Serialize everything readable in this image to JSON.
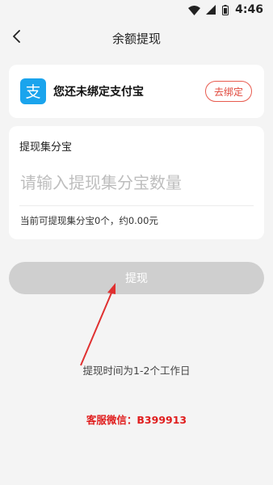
{
  "status_bar": {
    "time": "4:46",
    "icons": [
      "wifi-icon",
      "signal-icon",
      "battery-icon"
    ]
  },
  "nav": {
    "title": "余额提现",
    "back_icon": "chevron-left-icon"
  },
  "alipay": {
    "icon": "alipay-logo",
    "logo_char": "支",
    "status_text": "您还未绑定支付宝",
    "bind_label": "去绑定",
    "brand_color": "#1aa4ed",
    "accent_color": "#e0463a"
  },
  "withdraw": {
    "label": "提现集分宝",
    "amount_placeholder": "请输入提现集分宝数量",
    "amount_value": "",
    "available_text": "当前可提现集分宝0个，约0.00元",
    "button_label": "提现",
    "button_color": "#cfcfcf"
  },
  "notes": {
    "time_note": "提现时间为1-2个工作日",
    "service_text": "客服微信：B399913",
    "service_color": "#e01e1e"
  }
}
